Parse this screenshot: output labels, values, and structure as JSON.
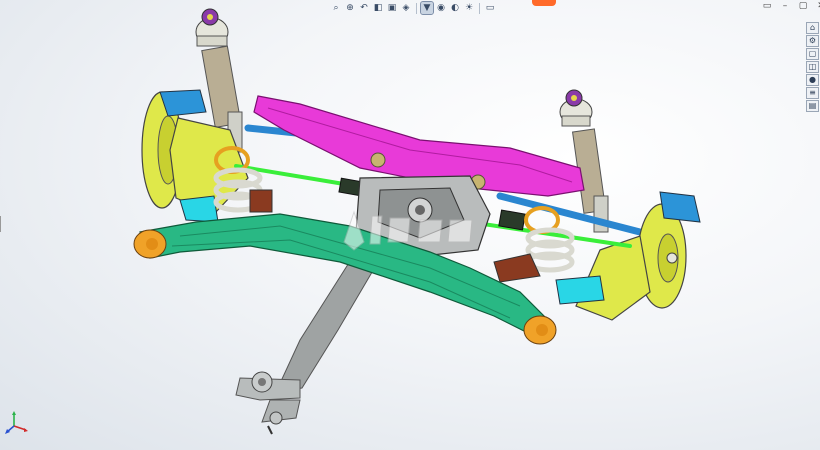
{
  "heads_up_toolbar": {
    "items": [
      {
        "name": "zoom-to-fit-icon",
        "glyph": "⌕"
      },
      {
        "name": "zoom-to-area-icon",
        "glyph": "⊕"
      },
      {
        "name": "previous-view-icon",
        "glyph": "↶"
      },
      {
        "name": "section-view-icon",
        "glyph": "◧"
      },
      {
        "name": "dynamic-annotation-icon",
        "glyph": "▣"
      },
      {
        "name": "view-orientation-icon",
        "glyph": "◈"
      },
      {
        "name": "display-style-icon",
        "glyph": "▼"
      },
      {
        "name": "hide-show-items-icon",
        "glyph": "◉"
      },
      {
        "name": "edit-appearance-icon",
        "glyph": "◐"
      },
      {
        "name": "apply-scene-icon",
        "glyph": "☀"
      },
      {
        "name": "view-settings-icon",
        "glyph": "▭"
      }
    ]
  },
  "window_controls": {
    "restore": "▭",
    "minimize": "–",
    "maximize": "▢",
    "close": "✕"
  },
  "task_pane": {
    "tabs": [
      {
        "name": "resources-tab-icon",
        "glyph": "⌂"
      },
      {
        "name": "design-library-tab-icon",
        "glyph": "⚙"
      },
      {
        "name": "file-explorer-tab-icon",
        "glyph": "▢"
      },
      {
        "name": "view-palette-tab-icon",
        "glyph": "◫"
      },
      {
        "name": "appearances-tab-icon",
        "glyph": "●"
      },
      {
        "name": "custom-properties-tab-icon",
        "glyph": "≡"
      },
      {
        "name": "solidworks-forum-tab-icon",
        "glyph": "▤"
      }
    ]
  },
  "colors": {
    "subframe_green": "#29b884",
    "crossmember_magenta": "#e83ad8",
    "knuckle_yellow": "#dfe84a",
    "arm_cyan": "#29d6e6",
    "driveshaft_green": "#3aee3a",
    "spring_silver": "#d9d9d0",
    "strut_tan": "#b9ae94",
    "propshaft_gray": "#9a9e9e",
    "bushing_orange": "#f0a228",
    "caliper_blue": "#2c94d8",
    "accent_brand": "#ff6a2a"
  }
}
